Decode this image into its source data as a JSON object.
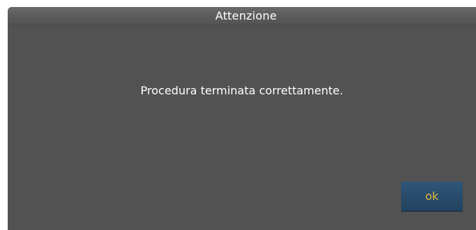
{
  "dialog": {
    "title": "Attenzione",
    "message": "Procedura terminata correttamente.",
    "ok_label": "ok"
  },
  "colors": {
    "dialog_background": "#525252",
    "title_text": "#ffffff",
    "message_text": "#ffffff",
    "ok_button_background": "#274a69",
    "ok_button_text": "#e6b93a"
  }
}
